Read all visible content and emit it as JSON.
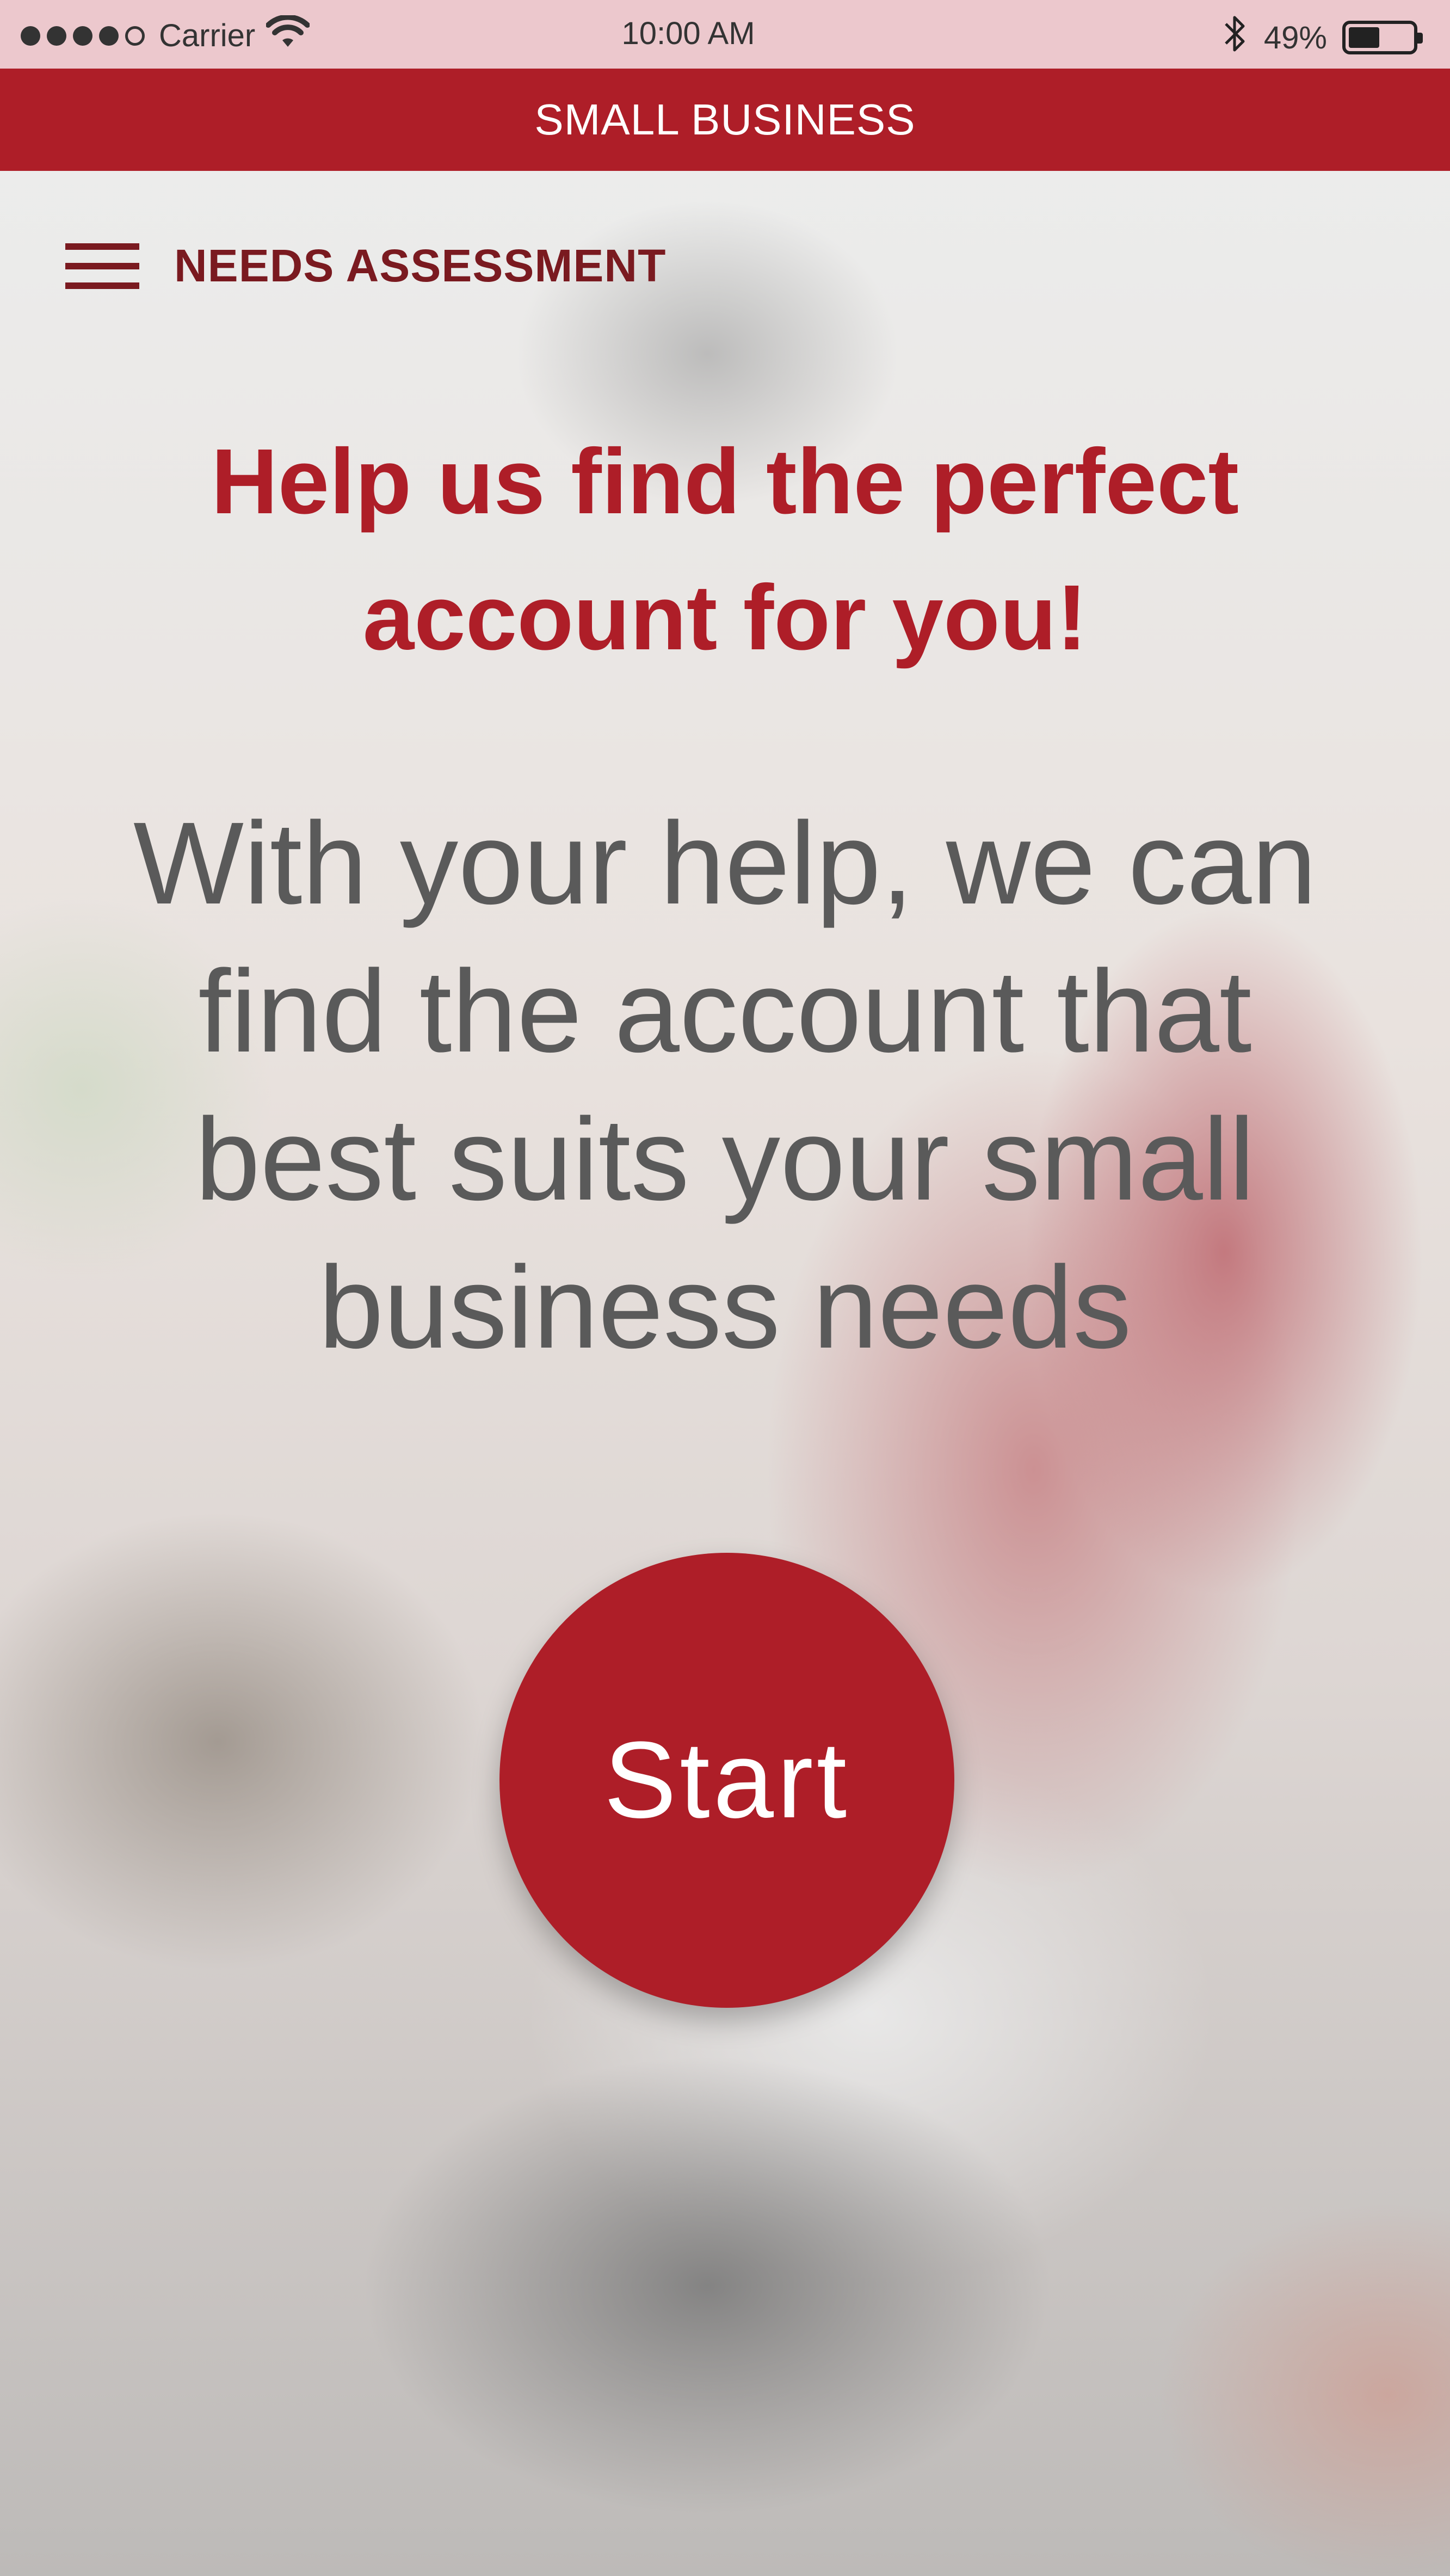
{
  "status_bar": {
    "carrier": "Carrier",
    "time": "10:00 AM",
    "battery": "49%",
    "battery_level": 0.49,
    "signal_bars": 4,
    "signal_max": 5
  },
  "header": {
    "title": "SMALL BUSINESS"
  },
  "nav": {
    "menu_icon": "hamburger-menu-icon",
    "section_title": "NEEDS ASSESSMENT"
  },
  "main": {
    "headline": "Help us find the perfect account for you!",
    "description": "With your help, we can find the account that best suits your small business needs",
    "start_label": "Start"
  },
  "colors": {
    "brand": "#ae1e28",
    "status_bar": "#ecc8cd",
    "nav_text": "#7a1a20",
    "body_text": "#5a5a5a"
  }
}
